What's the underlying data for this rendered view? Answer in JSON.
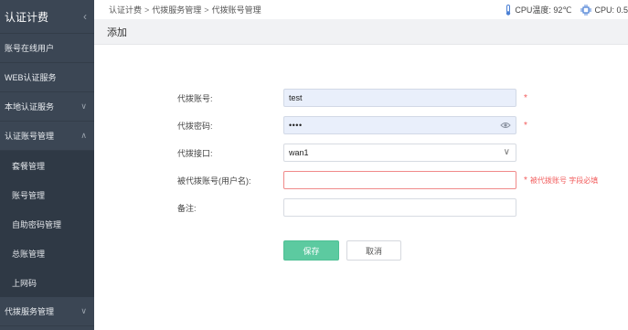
{
  "sidebar": {
    "title": "认证计费",
    "collapse_icon": "chevron-left-icon",
    "items": [
      {
        "label": "账号在线用户"
      },
      {
        "label": "WEB认证服务"
      },
      {
        "label": "本地认证服务",
        "icon": "chevron-down-icon"
      },
      {
        "label": "认证账号管理",
        "icon": "chevron-up-icon"
      },
      {
        "label": "代拨服务管理",
        "icon": "chevron-down-icon"
      }
    ],
    "subitems": [
      {
        "label": "套餐管理"
      },
      {
        "label": "账号管理"
      },
      {
        "label": "自助密码管理"
      },
      {
        "label": "总账管理"
      },
      {
        "label": "上网码"
      }
    ]
  },
  "breadcrumb": [
    "认证计费",
    "代拨服务管理",
    "代拨账号管理"
  ],
  "breadcrumb_sep": ">",
  "stats": {
    "cpu_temp": "CPU温度: 92℃",
    "cpu": "CPU: 0.5"
  },
  "page_title": "添加",
  "form": {
    "account": {
      "label": "代拨账号:",
      "value": "test",
      "required": "*"
    },
    "password": {
      "label": "代拨密码:",
      "value": "••••",
      "required": "*"
    },
    "interface": {
      "label": "代拨接口:",
      "value": "wan1"
    },
    "username": {
      "label": "被代拨账号(用户名):",
      "value": "",
      "required": "*",
      "error": "被代拨账号 字段必填"
    },
    "note": {
      "label": "备注:",
      "value": ""
    }
  },
  "buttons": {
    "save": "保存",
    "cancel": "取消"
  },
  "colors": {
    "sidebar_bg": "#3b4654",
    "submenu_bg": "#2f3945",
    "save_green": "#5ccaa0",
    "error_red": "#f25c5c"
  }
}
